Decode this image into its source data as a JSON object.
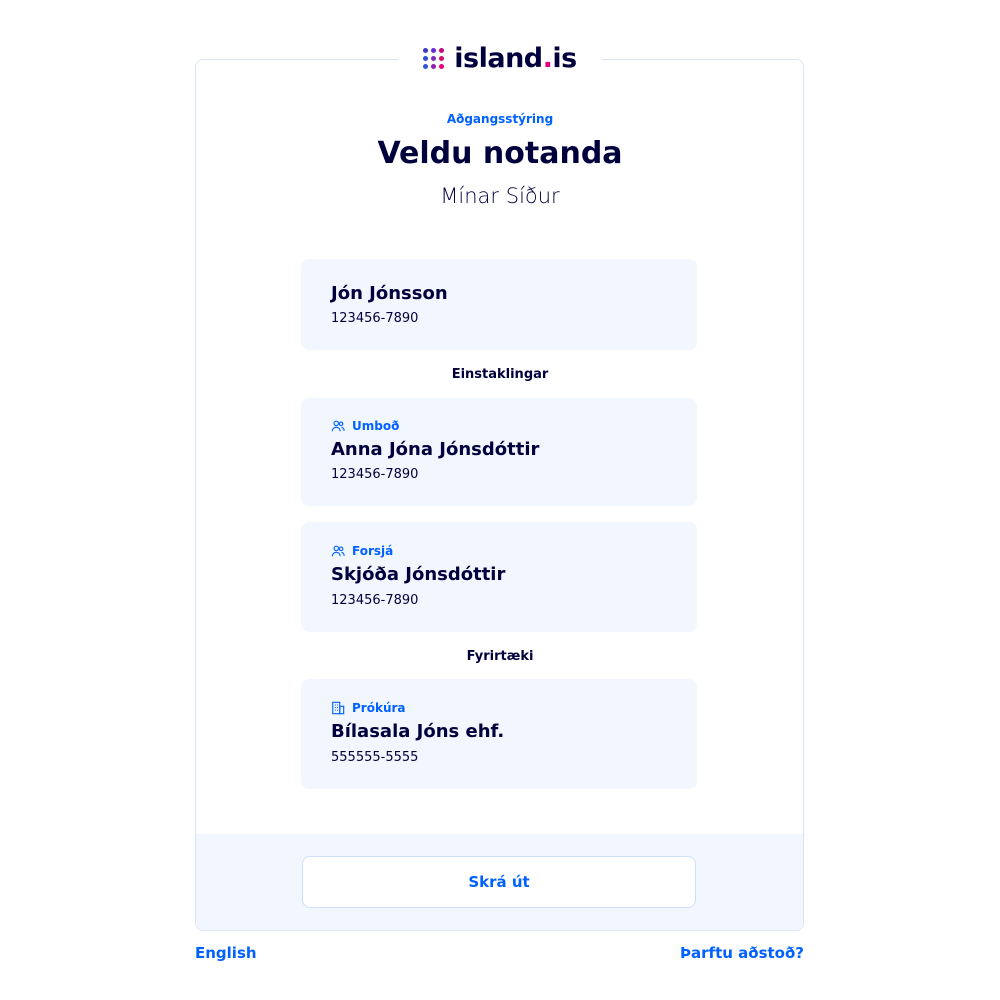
{
  "logo": {
    "text_main": "island",
    "text_dot": ".",
    "text_tld": "is",
    "dot_colors": [
      "#3f39c9",
      "#6a2ad6",
      "#c4087b",
      "#2c4bd6",
      "#7a2cc0",
      "#d1106b",
      "#3156d8",
      "#8d23b0",
      "#e6007e"
    ]
  },
  "header": {
    "eyebrow": "Aðgangsstýring",
    "title": "Veldu notanda",
    "subtitle": "Mínar Síður"
  },
  "current_user": {
    "name": "Jón Jónsson",
    "nid": "123456-7890"
  },
  "sections": {
    "individuals": "Einstaklingar",
    "companies": "Fyrirtæki"
  },
  "delegations": [
    {
      "tag": "Umboð",
      "icon": "users-icon",
      "name": "Anna Jóna Jónsdóttir",
      "nid": "123456-7890"
    },
    {
      "tag": "Forsjá",
      "icon": "users-icon",
      "name": "Skjóða Jónsdóttir",
      "nid": "123456-7890"
    },
    {
      "tag": "Prókúra",
      "icon": "building-icon",
      "name": "Bílasala Jóns ehf.",
      "nid": "555555-5555"
    }
  ],
  "actions": {
    "logout": "Skrá út"
  },
  "footer": {
    "language": "English",
    "help": "Þarftu aðstoð?"
  },
  "colors": {
    "accent": "#0061ff",
    "text": "#00003c",
    "card_bg": "#f2f7ff",
    "border": "#d9e6f5"
  }
}
